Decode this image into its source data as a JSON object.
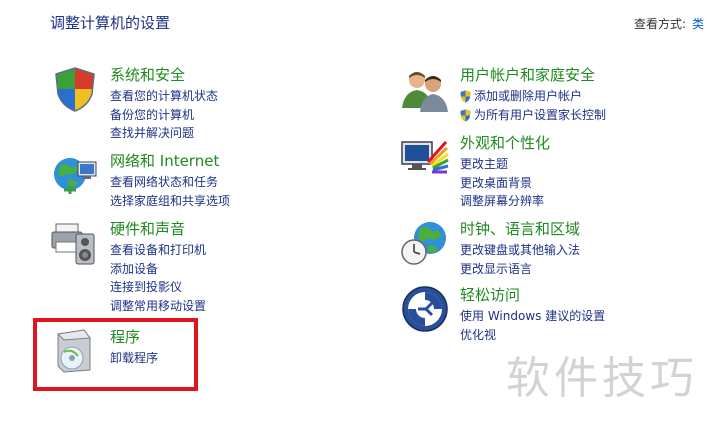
{
  "header": {
    "title": "调整计算机的设置",
    "view_by_label": "查看方式:",
    "view_by_value": "类"
  },
  "categories": [
    {
      "title": "系统和安全",
      "icon": "shield-icon",
      "links": [
        "查看您的计算机状态",
        "备份您的计算机",
        "查找并解决问题"
      ]
    },
    {
      "title": "网络和 Internet",
      "icon": "network-globe-icon",
      "links": [
        "查看网络状态和任务",
        "选择家庭组和共享选项"
      ]
    },
    {
      "title": "硬件和声音",
      "icon": "printer-speaker-icon",
      "links": [
        "查看设备和打印机",
        "添加设备",
        "连接到投影仪",
        "调整常用移动设置"
      ]
    },
    {
      "title": "程序",
      "icon": "program-box-icon",
      "links": [
        "卸载程序"
      ]
    },
    {
      "title": "用户帐户和家庭安全",
      "icon": "users-icon",
      "links": [
        "添加或删除用户帐户",
        "为所有用户设置家长控制"
      ]
    },
    {
      "title": "外观和个性化",
      "icon": "monitor-palette-icon",
      "links": [
        "更改主题",
        "更改桌面背景",
        "调整屏幕分辨率"
      ]
    },
    {
      "title": "时钟、语言和区域",
      "icon": "clock-globe-icon",
      "links": [
        "更改键盘或其他输入法",
        "更改显示语言"
      ]
    },
    {
      "title": "轻松访问",
      "icon": "accessibility-icon",
      "links": [
        "使用 Windows 建议的设置",
        "优化视"
      ]
    }
  ],
  "watermark": "软件技巧",
  "colors": {
    "heading_green": "#1f8a1f",
    "link_blue": "#1e3287",
    "highlight_red": "#e0141e"
  }
}
